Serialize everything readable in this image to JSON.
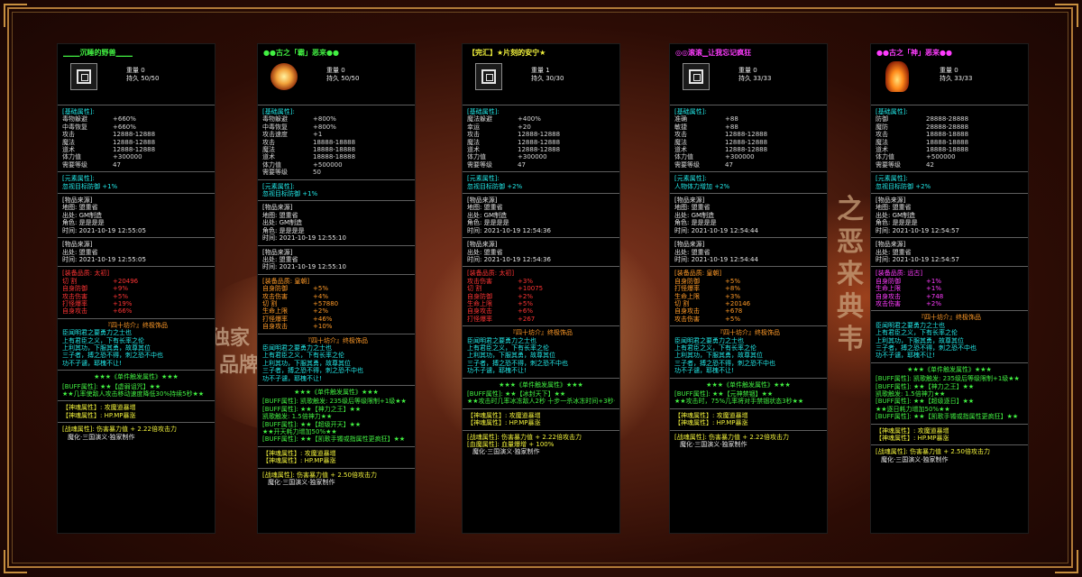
{
  "background": {
    "calligraphy": "之恶来典韦",
    "watermark_a": "独家",
    "watermark_b": "品牌"
  },
  "cards": [
    {
      "title": "▁▁▁沉睡的野兽▁▁▁",
      "title_color": "#42f042",
      "icon": "rune-icon",
      "weight": "重量 0",
      "durability": "持久 50/50",
      "base_header": "[基础属性]:",
      "base": [
        {
          "k": "毒物躲避",
          "v": "+660%"
        },
        {
          "k": "中毒恢复",
          "v": "+660%"
        },
        {
          "k": "攻击",
          "v": "12888-12888"
        },
        {
          "k": "魔法",
          "v": "12888-12888"
        },
        {
          "k": "道术",
          "v": "12888-12888"
        },
        {
          "k": "体力值",
          "v": "+300000"
        },
        {
          "k": "需要等级",
          "v": "47"
        }
      ],
      "element_header": "[元素属性]:",
      "element": "忽视目标防御 +1%",
      "source_header": "[物品来源]",
      "source": [
        "地图: 盟重省",
        "出处: GM制造",
        "角色: 是是是是",
        "时间: 2021-10-19 12:55:05"
      ],
      "source2_header": "[物品来源]",
      "source2": [
        "出处: 盟重省",
        "时间: 2021-10-19 12:55:05"
      ],
      "quality_header": "[装备品质: 太初]",
      "quality_color": "#ff3434",
      "quality": [
        {
          "k": "切   割",
          "v": "+20496"
        },
        {
          "k": "自身防御",
          "v": "+9%"
        },
        {
          "k": "攻击伤害",
          "v": "+5%"
        },
        {
          "k": "打怪爆率",
          "v": "+19%"
        },
        {
          "k": "自身攻击",
          "v": "+66%"
        }
      ],
      "set_title": "『四十坊介』终极饰品",
      "set_lines": [
        "臣闻明君之要勇力之士也",
        "上有君臣之义，下有长率之伦",
        "上利其功，下服其勇，故尊其位",
        "三子者，搏之恐不得，刺之恐不中也",
        "功不子谴，耶槐不让!"
      ],
      "buff_title": "★★★《单件触发属性》★★★",
      "buff_lines": [
        "[BUFF属性]: ★★【虚弱诅咒】★★",
        "★★几率使敌人攻击移动速度降低30%持续5秒★★"
      ],
      "soul": [
        "【神魂属性】: 攻魔道暴增",
        "【神魂属性】: HP.MP暴涨"
      ],
      "battle": "[战魂属性]: 伤害暴力值  + 2.22倍攻击力",
      "footer": "魔化·三国演义·独家制作"
    },
    {
      "title": "●●古之「霸」恶来●●",
      "title_color": "#42f042",
      "icon": "orb-icon",
      "weight": "重量 0",
      "durability": "持久 50/50",
      "base_header": "[基础属性]:",
      "base": [
        {
          "k": "毒物躲避",
          "v": "+800%"
        },
        {
          "k": "中毒恢复",
          "v": "+800%"
        },
        {
          "k": "攻击速度",
          "v": "+1"
        },
        {
          "k": "攻击",
          "v": "18888-18888"
        },
        {
          "k": "魔法",
          "v": "18888-18888"
        },
        {
          "k": "道术",
          "v": "18888-18888"
        },
        {
          "k": "体力值",
          "v": "+500000"
        },
        {
          "k": "需要等级",
          "v": "50"
        }
      ],
      "element_header": "[元素属性]:",
      "element": "忽视目标防御 +1%",
      "source_header": "[物品来源]",
      "source": [
        "地图: 盟重省",
        "出处: GM制造",
        "角色: 是是是是",
        "时间: 2021-10-19 12:55:10"
      ],
      "source2_header": "[物品来源]",
      "source2": [
        "出处: 盟重省",
        "时间: 2021-10-19 12:55:10"
      ],
      "quality_header": "[装备品质: 皇朝]",
      "quality_color": "#ff9a28",
      "quality": [
        {
          "k": "自身防御",
          "v": "+5%"
        },
        {
          "k": "攻击伤害",
          "v": "+4%"
        },
        {
          "k": "切   割",
          "v": "+57880"
        },
        {
          "k": "生命上限",
          "v": "+2%"
        },
        {
          "k": "打怪爆率",
          "v": "+46%"
        },
        {
          "k": "自身攻击",
          "v": "+10%"
        }
      ],
      "set_title": "『四十坊介』终极饰品",
      "set_lines": [
        "臣闻明君之要勇力之士也",
        "上有君臣之义，下有长率之伦",
        "上利其功，下服其勇，故尊其位",
        "三子者，搏之恐不得，刺之恐不中也",
        "功不子谴，耶槐不让!"
      ],
      "buff_title": "★★★《单件触发属性》★★★",
      "buff_lines": [
        "[BUFF属性]: 凯歌触发: 235级后等级限制+1级★★",
        "[BUFF属性]: ★★【神力之王】★★",
        "凯歌触发: 1.5倍神力★★",
        "[BUFF属性]: ★★【超级开天】★★",
        "★★开天耗力增加50%★★",
        "[BUFF属性]: ★★【凯歌手镯或指属性更疯狂】★★"
      ],
      "soul": [
        "【神魂属性】: 攻魔道暴增",
        "【神魂属性】: HP.MP暴涨"
      ],
      "battle": "[战魂属性]: 伤害暴力值  + 2.50倍攻击力",
      "footer": "魔化·三国演义·独家制作"
    },
    {
      "title": "【完汇】★片刻的安宁★",
      "title_color": "#f2f23c",
      "icon": "rune-icon",
      "weight": "重量 1",
      "durability": "持久 30/30",
      "base_header": "[基础属性]:",
      "base": [
        {
          "k": "魔法躲避",
          "v": "+400%"
        },
        {
          "k": "幸运",
          "v": "+20"
        },
        {
          "k": "攻击",
          "v": "12888-12888"
        },
        {
          "k": "魔法",
          "v": "12888-12888"
        },
        {
          "k": "道术",
          "v": "12888-12888"
        },
        {
          "k": "体力值",
          "v": "+300000"
        },
        {
          "k": "需要等级",
          "v": "47"
        }
      ],
      "element_header": "[元素属性]:",
      "element": "忽视目标防御 +2%",
      "source_header": "[物品来源]",
      "source": [
        "地图: 盟重省",
        "出处: GM制造",
        "角色: 是是是是",
        "时间: 2021-10-19 12:54:36"
      ],
      "source2_header": "[物品来源]",
      "source2": [
        "出处: 盟重省",
        "时间: 2021-10-19 12:54:36"
      ],
      "quality_header": "[装备品质: 太初]",
      "quality_color": "#ff3434",
      "quality": [
        {
          "k": "攻击伤害",
          "v": "+3%"
        },
        {
          "k": "切   割",
          "v": "+10075"
        },
        {
          "k": "自身防御",
          "v": "+2%"
        },
        {
          "k": "生命上限",
          "v": "+5%"
        },
        {
          "k": "自身攻击",
          "v": "+6%"
        },
        {
          "k": "打怪爆率",
          "v": "+267"
        }
      ],
      "set_title": "『四十坊介』终极饰品",
      "set_lines": [
        "臣闻明君之要勇力之士也",
        "上有君臣之义，下有长率之伦",
        "上利其功，下服其勇，故尊其位",
        "三子者，搏之恐不得，刺之恐不中也",
        "功不子谴，耶槐不让!"
      ],
      "buff_title": "★★★《单件触发属性》★★★",
      "buff_lines": [
        "[BUFF属性]: ★★【冰封天下】★★",
        "★★攻击时几率冰冻敌人2秒  十步一杀冰冻时间+3秒★★"
      ],
      "soul": [
        "【神魂属性】: 攻魔道暴增",
        "【神魂属性】: HP.MP暴涨"
      ],
      "battle": "[战魂属性]: 伤害暴力值  + 2.22倍攻击力",
      "battle2": "[血魔属性]: 血量爆增 + 100%",
      "footer": "魔化·三国演义·独家制作"
    },
    {
      "title": "◎◎滚滚▁让我忘记疯狂",
      "title_color": "#ff3cff",
      "icon": "rune-icon",
      "weight": "重量 0",
      "durability": "持久 33/33",
      "base_header": "[基础属性]:",
      "base": [
        {
          "k": "准确",
          "v": "+88"
        },
        {
          "k": "敏捷",
          "v": "+88"
        },
        {
          "k": "攻击",
          "v": "12888-12888"
        },
        {
          "k": "魔法",
          "v": "12888-12888"
        },
        {
          "k": "道术",
          "v": "12888-12888"
        },
        {
          "k": "体力值",
          "v": "+300000"
        },
        {
          "k": "需要等级",
          "v": "47"
        }
      ],
      "element_header": "[元素属性]:",
      "element": "人物体力增加 +2%",
      "source_header": "[物品来源]",
      "source": [
        "地图: 盟重省",
        "出处: GM制造",
        "角色: 是是是是",
        "时间: 2021-10-19 12:54:44"
      ],
      "source2_header": "[物品来源]",
      "source2": [
        "出处: 盟重省",
        "时间: 2021-10-19 12:54:44"
      ],
      "quality_header": "[装备品质: 皇朝]",
      "quality_color": "#ff9a28",
      "quality": [
        {
          "k": "自身防御",
          "v": "+5%"
        },
        {
          "k": "打怪爆率",
          "v": "+8%"
        },
        {
          "k": "生命上限",
          "v": "+3%"
        },
        {
          "k": "切   割",
          "v": "+20146"
        },
        {
          "k": "自身攻击",
          "v": "+678"
        },
        {
          "k": "攻击伤害",
          "v": "+5%"
        }
      ],
      "set_title": "『四十坊介』终极饰品",
      "set_lines": [
        "臣闻明君之要勇力之士也",
        "上有君臣之义，下有长率之伦",
        "上利其功，下服其勇，故尊其位",
        "三子者，搏之恐不得，刺之恐不中也",
        "功不子谴，耶槐不让!"
      ],
      "buff_title": "★★★《单件触发属性》★★★",
      "buff_lines": [
        "[BUFF属性]: ★★【元神禁锢】★★",
        "★★攻击时，75%几率将对手禁锢状态3秒★★"
      ],
      "soul": [
        "【神魂属性】: 攻魔道暴增",
        "【神魂属性】: HP.MP暴涨"
      ],
      "battle": "[战魂属性]: 伤害暴力值  + 2.22倍攻击力",
      "footer": "魔化·三国演义·独家制作"
    },
    {
      "title": "●●古之「神」恶来●●",
      "title_color": "#ff3cff",
      "icon": "fire-icon",
      "weight": "重量 0",
      "durability": "持久 33/33",
      "base_header": "[基础属性]:",
      "base": [
        {
          "k": "防御",
          "v": "28888-28888"
        },
        {
          "k": "魔防",
          "v": "28888-28888"
        },
        {
          "k": "攻击",
          "v": "18888-18888"
        },
        {
          "k": "魔法",
          "v": "18888-18888"
        },
        {
          "k": "道术",
          "v": "18888-18888"
        },
        {
          "k": "体力值",
          "v": "+500000"
        },
        {
          "k": "需要等级",
          "v": "42"
        }
      ],
      "element_header": "[元素属性]:",
      "element": "忽视目标防御 +2%",
      "source_header": "[物品来源]",
      "source": [
        "地图: 盟重省",
        "出处: GM制造",
        "角色: 是是是是",
        "时间: 2021-10-19 12:54:57"
      ],
      "source2_header": "[物品来源]",
      "source2": [
        "出处: 盟重省",
        "时间: 2021-10-19 12:54:57"
      ],
      "quality_header": "[装备品质: 远古]",
      "quality_color": "#ff3cff",
      "quality": [
        {
          "k": "自身防御",
          "v": "+1%"
        },
        {
          "k": "生命上限",
          "v": "+1%"
        },
        {
          "k": "自身攻击",
          "v": "+748"
        },
        {
          "k": "攻击伤害",
          "v": "+2%"
        }
      ],
      "set_title": "『四十坊介』终极饰品",
      "set_lines": [
        "臣闻明君之要勇力之士也",
        "上有君臣之义，下有长率之伦",
        "上利其功，下服其勇，故尊其位",
        "三子者，搏之恐不得，刺之恐不中也",
        "功不子谴，耶槐不让!"
      ],
      "buff_title": "★★★《单件触发属性》★★★",
      "buff_lines": [
        "[BUFF属性]: 凯歌触发: 235级后等级限制+1级★★",
        "[BUFF属性]: ★★【神力之王】★★",
        "凯歌触发: 1.5倍神力★★",
        "[BUFF属性]: ★★【超级逐日】★★",
        "★★逐日耗力增加50%★★",
        "[BUFF属性]: ★★【凯歌手镯或指属性更疯狂】★★"
      ],
      "soul": [
        "【神魂属性】: 攻魔道暴增",
        "【神魂属性】: HP.MP暴涨"
      ],
      "battle": "[战魂属性]: 伤害暴力值  + 2.50倍攻击力",
      "footer": "魔化·三国演义·独家制作"
    }
  ]
}
